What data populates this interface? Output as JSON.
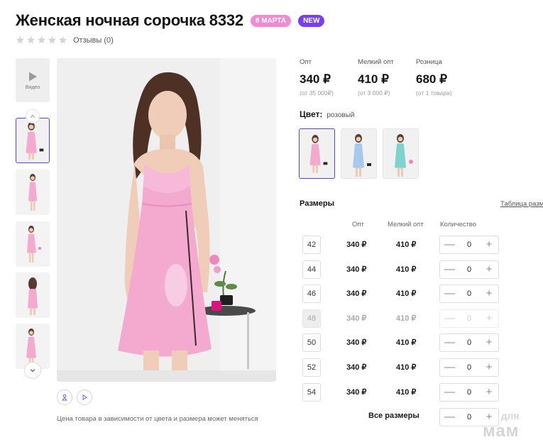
{
  "product": {
    "title": "Женская ночная сорочка 8332",
    "badges": [
      "8 МАРТА",
      "NEW"
    ],
    "reviews_label": "Отзывы (0)",
    "rating": 0
  },
  "gallery": {
    "video_label": "Видео",
    "price_note": "Цена товара в зависимости от цвета и размера может меняться"
  },
  "prices": [
    {
      "label": "Опт",
      "value": "340 ₽",
      "note": "(от 35 000₽)"
    },
    {
      "label": "Мелкий опт",
      "value": "410 ₽",
      "note": "(от 3 000 ₽)"
    },
    {
      "label": "Розница",
      "value": "680 ₽",
      "note": "(от 1 товара)"
    }
  ],
  "color": {
    "label": "Цвет:",
    "selected": "розовый",
    "swatches": [
      "#f4a9cf",
      "#a9c9ec",
      "#7fd3cf"
    ]
  },
  "sizes": {
    "title": "Размеры",
    "table_link": "Таблица разм",
    "headers": [
      "Опт",
      "Мелкий опт",
      "Количество"
    ],
    "rows": [
      {
        "size": "42",
        "opt": "340 ₽",
        "small": "410 ₽",
        "qty": "0",
        "disabled": false
      },
      {
        "size": "44",
        "opt": "340 ₽",
        "small": "410 ₽",
        "qty": "0",
        "disabled": false
      },
      {
        "size": "46",
        "opt": "340 ₽",
        "small": "410 ₽",
        "qty": "0",
        "disabled": false
      },
      {
        "size": "48",
        "opt": "340 ₽",
        "small": "410 ₽",
        "qty": "0",
        "disabled": true
      },
      {
        "size": "50",
        "opt": "340 ₽",
        "small": "410 ₽",
        "qty": "0",
        "disabled": false
      },
      {
        "size": "52",
        "opt": "340 ₽",
        "small": "410 ₽",
        "qty": "0",
        "disabled": false
      },
      {
        "size": "54",
        "opt": "340 ₽",
        "small": "410 ₽",
        "qty": "0",
        "disabled": false
      }
    ],
    "all_label": "Все размеры",
    "all_qty": "0",
    "minus": "—",
    "plus": "+"
  },
  "watermark": {
    "top": "для",
    "bottom": "мам"
  },
  "colors": {
    "accent": "#5b3fd8",
    "badge_march": "#f08ad2",
    "badge_new": "#7b3ff2",
    "dress": "#f4a9cf"
  }
}
